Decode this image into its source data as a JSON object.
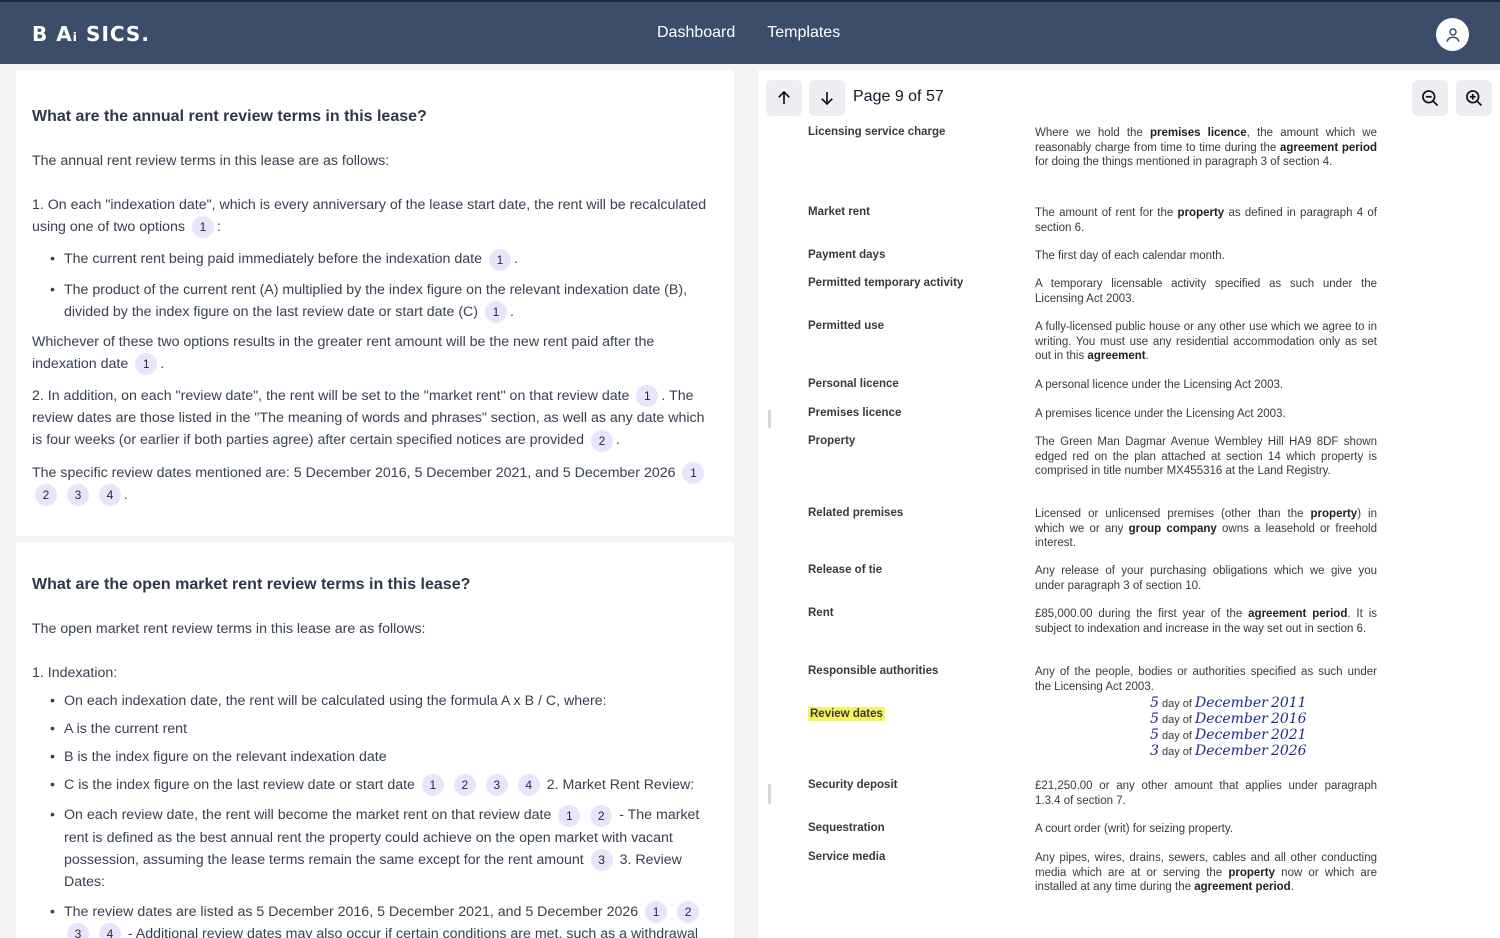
{
  "app": {
    "logo": "B Aᵢ SICS."
  },
  "nav": {
    "dashboard": "Dashboard",
    "templates": "Templates"
  },
  "qa": [
    {
      "question": "What are the annual rent review terms in this lease?",
      "intro": "The annual rent review terms in this lease are as follows:",
      "p1": "1. On each \"indexation date\", which is every anniversary of the lease start date, the rent will be recalculated using one of two options",
      "p1_cites": [
        "1"
      ],
      "bullet1": "The current rent being paid immediately before the indexation date",
      "bullet1_cites": [
        "1"
      ],
      "bullet2": "The product of the current rent (A) multiplied by the index figure on the relevant indexation date (B), divided by the index figure on the last review date or start date (C)",
      "bullet2_cites": [
        "1"
      ],
      "p2": "Whichever of these two options results in the greater rent amount will be the new rent paid after the indexation date",
      "p2_cites": [
        "1"
      ],
      "p3a": "2. In addition, on each \"review date\", the rent will be set to the \"market rent\" on that review date",
      "p3a_cites": [
        "1"
      ],
      "p3b": "The review dates are those listed in the \"The meaning of words and phrases\" section, as well as any date which is four weeks (or earlier if both parties agree) after certain specified notices are provided",
      "p3b_cites": [
        "2"
      ],
      "p4": "The specific review dates mentioned are: 5 December 2016, 5 December 2021, and 5 December 2026",
      "p4_cites": [
        "1",
        "2",
        "3",
        "4"
      ]
    },
    {
      "question": "What are the open market rent review terms in this lease?",
      "intro": "The open market rent review terms in this lease are as follows:",
      "h1": "1. Indexation:",
      "b1": "On each indexation date, the rent will be calculated using the formula A x B / C, where:",
      "b2": "A is the current rent",
      "b3": "B is the index figure on the relevant indexation date",
      "b4": "C is the index figure on the last review date or start date",
      "b4_cites": [
        "1",
        "2",
        "3",
        "4"
      ],
      "b4_tail": "2. Market Rent Review:",
      "b5a": "On each review date, the rent will become the market rent on that review date",
      "b5a_cites": [
        "1",
        "2"
      ],
      "b5b": "- The market rent is defined as the best annual rent the property could achieve on the open market with vacant possession, assuming the lease terms remain the same except for the rent amount",
      "b5b_cites": [
        "3"
      ],
      "b5c": "3. Review Dates:",
      "b6": "The review dates are listed as 5 December 2016, 5 December 2021, and 5 December 2026",
      "b6_cites": [
        "1",
        "2",
        "3",
        "4"
      ],
      "b6_tail": "- Additional review dates may also occur if certain conditions are met, such as a withdrawal"
    }
  ],
  "viewer": {
    "page_indicator": "Page 9 of 57",
    "rows": [
      {
        "term": "Licensing service charge",
        "def": "Where we hold the <b>premises licence</b>, the amount which we reasonably charge from time to time during the <b>agreement period</b> for doing the things mentioned in paragraph 3 of section 4."
      },
      {
        "term": "Market rent",
        "def": "The amount of rent for the <b>property</b> as defined in paragraph 4 of section 6."
      },
      {
        "term": "Payment days",
        "def": "The first day of each calendar month."
      },
      {
        "term": "Permitted temporary activity",
        "def": "A temporary licensable activity specified as such under the Licensing Act 2003."
      },
      {
        "term": "Permitted use",
        "def": "A fully-licensed public house or any other use which we agree to in writing.  You must use any residential accommodation only as set out in this <b>agreement</b>."
      },
      {
        "term": "Personal licence",
        "def": "A personal licence under the Licensing Act 2003."
      },
      {
        "term": "Premises licence",
        "def": "A premises licence under the Licensing Act 2003."
      },
      {
        "term": "Property",
        "def": "The Green Man Dagmar Avenue Wembley Hill HA9 8DF shown edged red on the plan attached at section 14 which property is comprised in title number MX455316 at the Land Registry."
      },
      {
        "term": "Related premises",
        "def": "Licensed or unlicensed premises (other than the <b>property</b>) in which we or any <b>group company</b> owns a leasehold or freehold interest."
      },
      {
        "term": "Release of tie",
        "def": "Any release of your purchasing obligations which we give you under paragraph 3 of section 10."
      },
      {
        "term": "Rent",
        "def": "£85,000.00 during the first year of the <b>agreement period</b>. It is subject to indexation and increase in the way set out in section 6."
      },
      {
        "term": "Responsible authorities",
        "def": "Any of the people, bodies or authorities specified as such under the Licensing Act 2003."
      },
      {
        "term": "Review dates",
        "def": ""
      },
      {
        "term": "Security deposit",
        "def": "£21,250.00 or any other amount that applies under paragraph 1.3.4 of section 7."
      },
      {
        "term": "Sequestration",
        "def": "A court order (writ) for seizing property."
      },
      {
        "term": "Service media",
        "def": "Any pipes, wires, drains, sewers, cables and all other conducting media which are at or serving the <b>property</b> now or which are installed at any time during the <b>agreement period</b>."
      }
    ],
    "review_dates_handwritten": [
      {
        "day": "5",
        "label": "day of",
        "month": "December",
        "year": "2011"
      },
      {
        "day": "5",
        "label": "day of",
        "month": "December",
        "year": "2016"
      },
      {
        "day": "5",
        "label": "day of",
        "month": "December",
        "year": "2021"
      },
      {
        "day": "3",
        "label": "day of",
        "month": "December",
        "year": "2026"
      }
    ]
  }
}
